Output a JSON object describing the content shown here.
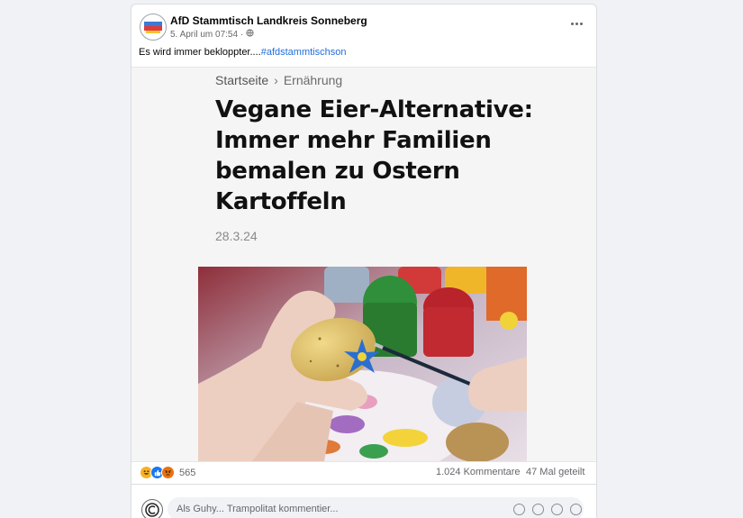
{
  "post": {
    "page_name": "AfD Stammtisch Landkreis Sonneberg",
    "date": "5. April um 07:54 ·",
    "privacy_icon": "globe-icon",
    "more_icon": "more-options-icon",
    "caption_text": "Es wird immer bekloppter....",
    "caption_hashtag": "#afdstammtischson"
  },
  "shared": {
    "breadcrumb_home": "Startseite",
    "breadcrumb_sep": "›",
    "breadcrumb_section": "Ernährung",
    "headline": "Vegane Eier-Alternative: Immer mehr Familien bemalen zu Ostern Kartoffeln",
    "date": "28.3.24"
  },
  "stats": {
    "reaction_icons": [
      "haha-icon",
      "like-icon",
      "angry-icon"
    ],
    "reaction_count": "565",
    "comments": "1.024 Kommentare",
    "shares": "47 Mal geteilt"
  },
  "composer": {
    "placeholder": "Als Guhy... Trampolitat kommentier..."
  },
  "colors": {
    "background": "#f0f2f5",
    "hashtag": "#216fdb",
    "like": "#1877f2",
    "haha": "#f7b125",
    "angry": "#e9710f"
  }
}
